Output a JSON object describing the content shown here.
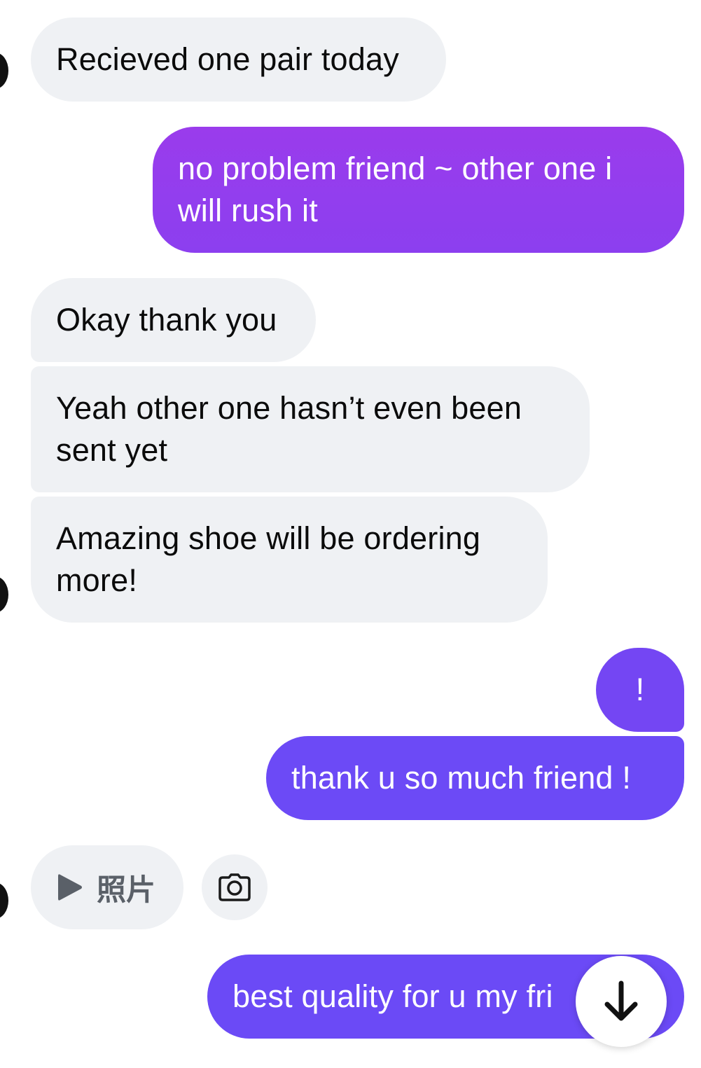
{
  "messages": [
    {
      "side": "in",
      "text": "Recieved one pair today"
    },
    {
      "side": "out",
      "text": "no problem friend ~ other one i will rush it"
    },
    {
      "side": "in",
      "text": "Okay thank you"
    },
    {
      "side": "in",
      "text": "Yeah other one hasn’t even been sent yet"
    },
    {
      "side": "in",
      "text": "Amazing shoe will be ordering more!"
    },
    {
      "side": "out",
      "text": "!"
    },
    {
      "side": "out",
      "text": "thank u so much friend !"
    },
    {
      "side": "out",
      "text": "best quality for u my fri"
    }
  ],
  "attachment": {
    "label": "照片",
    "play_icon": "play-icon",
    "camera_icon": "camera-icon"
  },
  "scroll_button": {
    "icon": "arrow-down-icon"
  },
  "colors": {
    "incoming_bg": "#eff1f4",
    "incoming_text": "#0b0b0b",
    "outgoing_purple_top": "#9a3cec",
    "outgoing_purple": "#7c45f2",
    "outgoing_blue_purple": "#6c4af6",
    "outgoing_text": "#ffffff"
  }
}
